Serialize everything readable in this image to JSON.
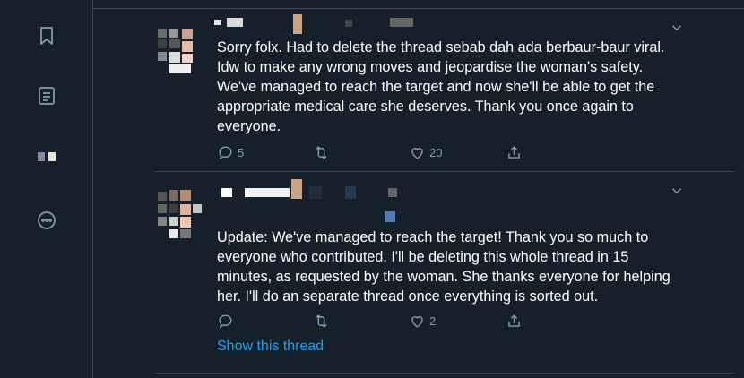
{
  "sidebar": {
    "items": [
      {
        "icon": "bookmark-icon"
      },
      {
        "icon": "lists-icon"
      },
      {
        "icon": "profile-icon"
      },
      {
        "icon": "more-icon"
      }
    ]
  },
  "tweets": [
    {
      "text": "Sorry folx. Had to delete the thread sebab dah ada berbaur-baur viral.\nIdw to make any wrong moves and jeopardise the woman's safety.\nWe've managed to reach the target and now she'll be able to get the\nappropriate medical care she deserves. Thank you once again to\neveryone.",
      "replies": "5",
      "retweets": "",
      "likes": "20"
    },
    {
      "text": "Update: We've managed to reach the target! Thank you so much to\neveryone who contributed. I'll be deleting this whole thread in 15\nminutes, as requested by the woman. She thanks everyone for helping\nher. I'll do an separate thread once everything is sorted out.",
      "replies": "",
      "retweets": "",
      "likes": "2",
      "show_thread": "Show this thread"
    }
  ],
  "colors": {
    "background": "#15202b",
    "border": "#38444d",
    "muted": "#8899a6",
    "accent": "#1da1f2"
  }
}
